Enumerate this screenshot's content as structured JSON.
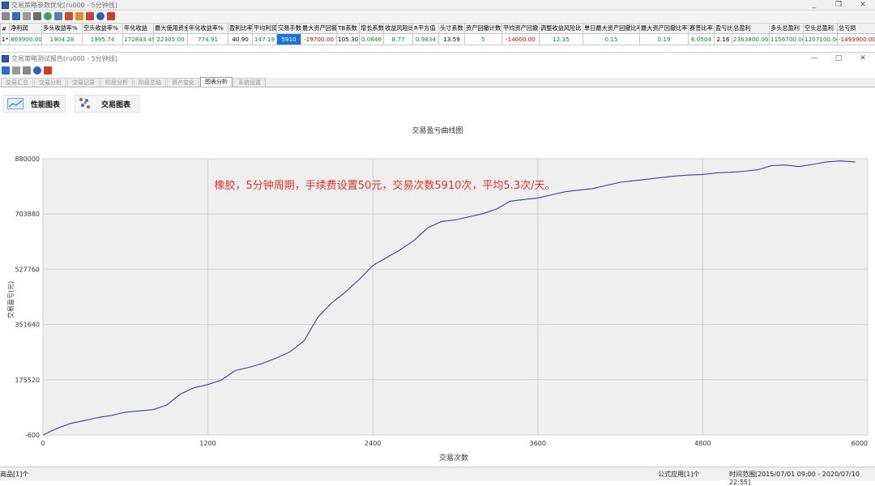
{
  "window": {
    "title": "交易策略参数优化[ru000 - 5分钟线]",
    "controls": [
      "_",
      "❐",
      "✕"
    ]
  },
  "grid": {
    "headers": [
      "#",
      "净利润",
      "多头收益率%",
      "空头收益率%",
      "年化收益",
      "最大使用资金",
      "年化收益率%",
      "盈利比率",
      "平均利润",
      "交易手数",
      "最大资产回撤",
      "TB系数",
      "增长系数",
      "收益风险比",
      "R平方值",
      "头寸系数",
      "资产回撤计数",
      "平均资产回撤",
      "调整收益风险比",
      "单日最大资产回撤比率%",
      "最大资产回撤比率%",
      "赛普比率",
      "盈亏比",
      "总盈利",
      "多头总盈利",
      "空头总盈利",
      "总亏损"
    ],
    "row": [
      "1*",
      "869900.00",
      "1904.28",
      "1995.74",
      "172843.49",
      "22305.00",
      "774.91",
      "40.90",
      "147.19",
      "5910",
      "-19700.00",
      "105.30",
      "0.0846",
      "8.77",
      "0.9834",
      "13.59",
      "5",
      "-14000.00",
      "12.35",
      "0.15",
      "0.19",
      "6.0504",
      "2.16",
      "2363800.00",
      "1156700.00",
      "1207100.00",
      "-1493900.00"
    ]
  },
  "sub_window": {
    "title": "交易策略测试报告[ru000 - 5分钟线]",
    "controls": [
      "—",
      "□",
      "✕"
    ]
  },
  "tabs": [
    "交易汇总",
    "交易分析",
    "交易记录",
    "阶段分析",
    "阶段总结",
    "资产变化",
    "图表分析",
    "系统设置"
  ],
  "active_tab": 6,
  "buttons": {
    "perf_chart": "性能图表",
    "trade_chart": "交易图表"
  },
  "chart_data": {
    "type": "line",
    "title": "交易盈亏曲线图",
    "xlabel": "交易次数",
    "ylabel": "交易盈亏(元)",
    "annotation": "橡胶，5分钟周期，手续费设置50元，交易次数5910次，平均5.3次/天。",
    "xlim": [
      0,
      6000
    ],
    "ylim": [
      -600,
      880000
    ],
    "x_ticks": [
      0,
      1200,
      2400,
      3600,
      4800,
      6000
    ],
    "y_ticks": [
      -600,
      175520,
      351640,
      527760,
      703880,
      880000
    ],
    "grid": true,
    "series": [
      {
        "color": "#3b3bab",
        "x": [
          0,
          100,
          200,
          300,
          400,
          500,
          600,
          700,
          800,
          900,
          1000,
          1100,
          1200,
          1300,
          1400,
          1500,
          1600,
          1700,
          1800,
          1900,
          2000,
          2100,
          2200,
          2300,
          2400,
          2500,
          2600,
          2700,
          2800,
          2900,
          3000,
          3100,
          3200,
          3300,
          3400,
          3500,
          3600,
          3700,
          3800,
          3900,
          4000,
          4100,
          4200,
          4300,
          4400,
          4500,
          4600,
          4700,
          4800,
          4900,
          5000,
          5100,
          5200,
          5300,
          5400,
          5500,
          5600,
          5700,
          5800,
          5910
        ],
        "y": [
          -600,
          20000,
          36000,
          45000,
          55000,
          62000,
          72000,
          76000,
          80000,
          95000,
          130000,
          150000,
          160000,
          175000,
          205000,
          215000,
          228000,
          245000,
          265000,
          300000,
          375000,
          420000,
          455000,
          495000,
          540000,
          565000,
          590000,
          620000,
          660000,
          680000,
          685000,
          695000,
          705000,
          720000,
          745000,
          750000,
          755000,
          765000,
          775000,
          780000,
          785000,
          795000,
          805000,
          810000,
          815000,
          820000,
          825000,
          828000,
          830000,
          835000,
          837000,
          840000,
          845000,
          858000,
          860000,
          855000,
          862000,
          870000,
          873000,
          870000
        ]
      }
    ]
  },
  "status": {
    "left": "商品[1]个",
    "formula": "公式应用[1]个",
    "range": "时间范围[2015/07/01 09:00 - 2020/07/10 22:55]"
  },
  "colors": {
    "line": "#3b3bab",
    "annotation": "#e0322a",
    "highlight": "#1a73d8",
    "positive": "#0a8a2a",
    "negative": "#d20000"
  }
}
